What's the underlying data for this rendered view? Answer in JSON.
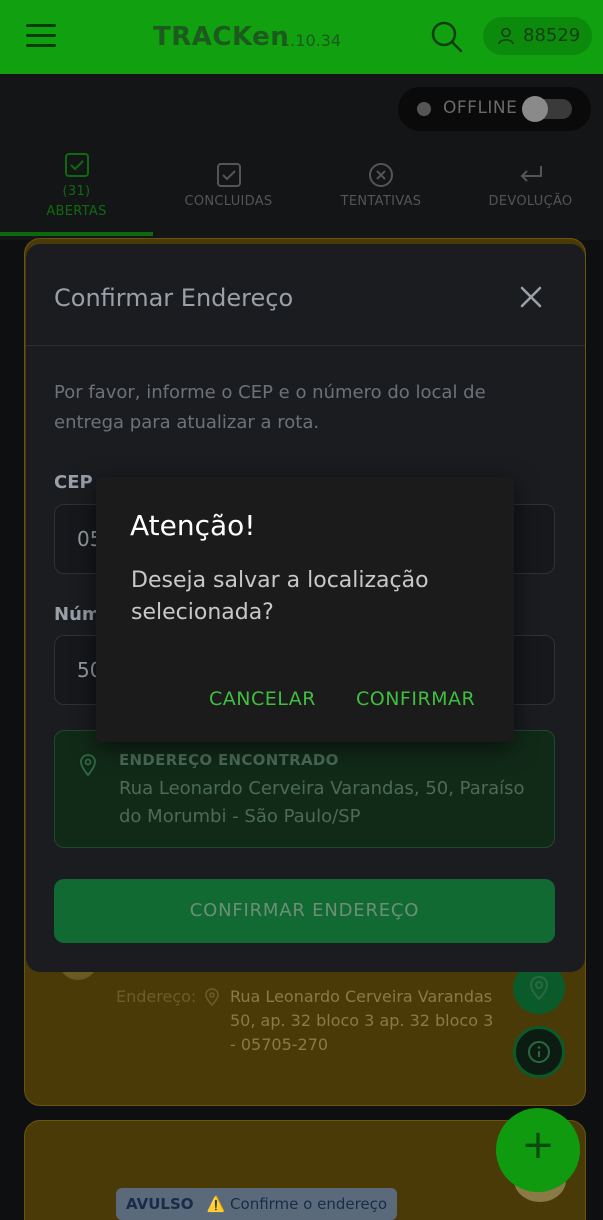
{
  "app": {
    "title": "TRACKen",
    "version": "1.10.34",
    "user_id": "88529"
  },
  "status": {
    "label": "OFFLINE",
    "online": false
  },
  "tabs": [
    {
      "count": "(31)",
      "label": "ABERTAS",
      "icon": "checkbox-icon",
      "active": true
    },
    {
      "label": "CONCLUIDAS",
      "icon": "checkbox-icon"
    },
    {
      "label": "TENTATIVAS",
      "icon": "close-circle-icon"
    },
    {
      "label": "DEVOLUÇÃO",
      "icon": "return-arrow-icon"
    }
  ],
  "background": {
    "address_label": "Endereço:",
    "address": "Rua Leonardo Cerveira Varandas 50, ap. 32 bloco 3 ap. 32 bloco 3 - 05705-270",
    "badge_type": "AVULSO",
    "badge_warning": "⚠️ Confirme o endereço"
  },
  "modal": {
    "title": "Confirmar Endereço",
    "description": "Por favor, informe o CEP e o número do local de entrega para atualizar a rota.",
    "cep_label": "CEP",
    "cep_value_partial": "05",
    "number_label": "Núm",
    "number_value_partial": "50",
    "found_title": "ENDEREÇO ENCONTRADO",
    "found_address": "Rua Leonardo Cerveira Varandas, 50, Paraíso do Morumbi - São Paulo/SP",
    "confirm_label": "CONFIRMAR ENDEREÇO"
  },
  "alert": {
    "title": "Atenção!",
    "message": "Deseja salvar a localização selecionada?",
    "cancel_label": "CANCELAR",
    "confirm_label": "CONFIRMAR"
  },
  "colors": {
    "brand": "#10a010",
    "accent_green": "#3fbf3f",
    "card_yellow": "#4a3a08"
  }
}
